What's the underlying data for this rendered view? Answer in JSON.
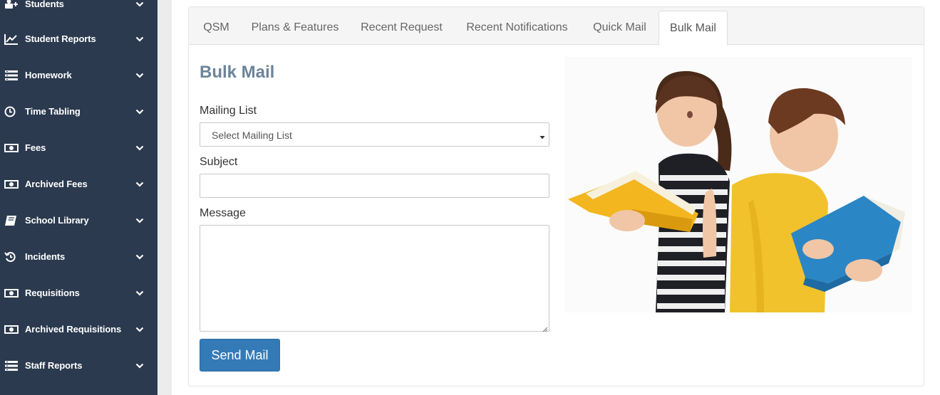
{
  "sidebar": {
    "items": [
      {
        "label": "Students",
        "icon": "add-user-icon"
      },
      {
        "label": "Student Reports",
        "icon": "line-chart-icon"
      },
      {
        "label": "Homework",
        "icon": "list-icon"
      },
      {
        "label": "Time Tabling",
        "icon": "clock-icon"
      },
      {
        "label": "Fees",
        "icon": "money-icon"
      },
      {
        "label": "Archived Fees",
        "icon": "money-icon"
      },
      {
        "label": "School Library",
        "icon": "book-icon"
      },
      {
        "label": "Incidents",
        "icon": "history-icon"
      },
      {
        "label": "Requisitions",
        "icon": "money-icon"
      },
      {
        "label": "Archived Requisitions",
        "icon": "money-icon"
      },
      {
        "label": "Staff Reports",
        "icon": "list-icon"
      }
    ]
  },
  "tabs": [
    {
      "label": "QSM",
      "active": false
    },
    {
      "label": "Plans & Features",
      "active": false
    },
    {
      "label": "Recent Request",
      "active": false
    },
    {
      "label": "Recent Notifications",
      "active": false
    },
    {
      "label": "Quick Mail",
      "active": false
    },
    {
      "label": "Bulk Mail",
      "active": true
    }
  ],
  "form": {
    "title": "Bulk Mail",
    "mailing_list_label": "Mailing List",
    "mailing_list_value": "Select Mailing List",
    "subject_label": "Subject",
    "subject_value": "",
    "message_label": "Message",
    "message_value": "",
    "send_label": "Send Mail"
  },
  "colors": {
    "sidebar_bg": "#2b3a4f",
    "title": "#6b849a",
    "primary_button": "#337ab7"
  }
}
